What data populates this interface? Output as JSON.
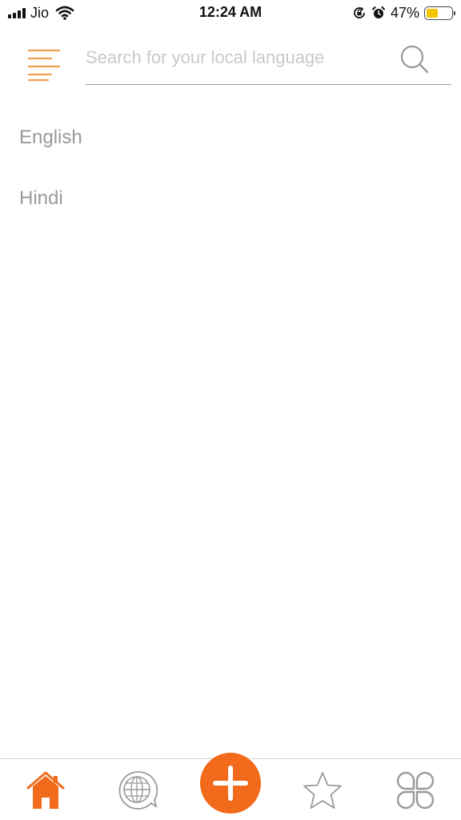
{
  "status_bar": {
    "carrier": "Jio",
    "time": "12:24 AM",
    "battery_percent": "47%",
    "battery_level": 0.47,
    "icons": [
      "signal-icon",
      "wifi-icon",
      "orientation-lock-icon",
      "alarm-icon",
      "battery-icon"
    ]
  },
  "header": {
    "menu_icon": "menu-icon",
    "search_placeholder": "Search for your local language",
    "search_value": "",
    "search_icon": "search-icon"
  },
  "languages": [
    {
      "label": "English"
    },
    {
      "label": "Hindi"
    }
  ],
  "bottom_nav": {
    "items": [
      {
        "icon": "home-icon",
        "active": true
      },
      {
        "icon": "globe-chat-icon",
        "active": false
      },
      {
        "icon": "add-icon",
        "active": false
      },
      {
        "icon": "star-icon",
        "active": false
      },
      {
        "icon": "apps-icon",
        "active": false
      }
    ]
  },
  "colors": {
    "accent": "#f26a1b",
    "menu_lines": "#f0a050",
    "inactive_icon": "#9a9a9a",
    "list_text": "#9a9a9a",
    "placeholder": "#c9c9c9",
    "battery_fill": "#f5c400"
  }
}
